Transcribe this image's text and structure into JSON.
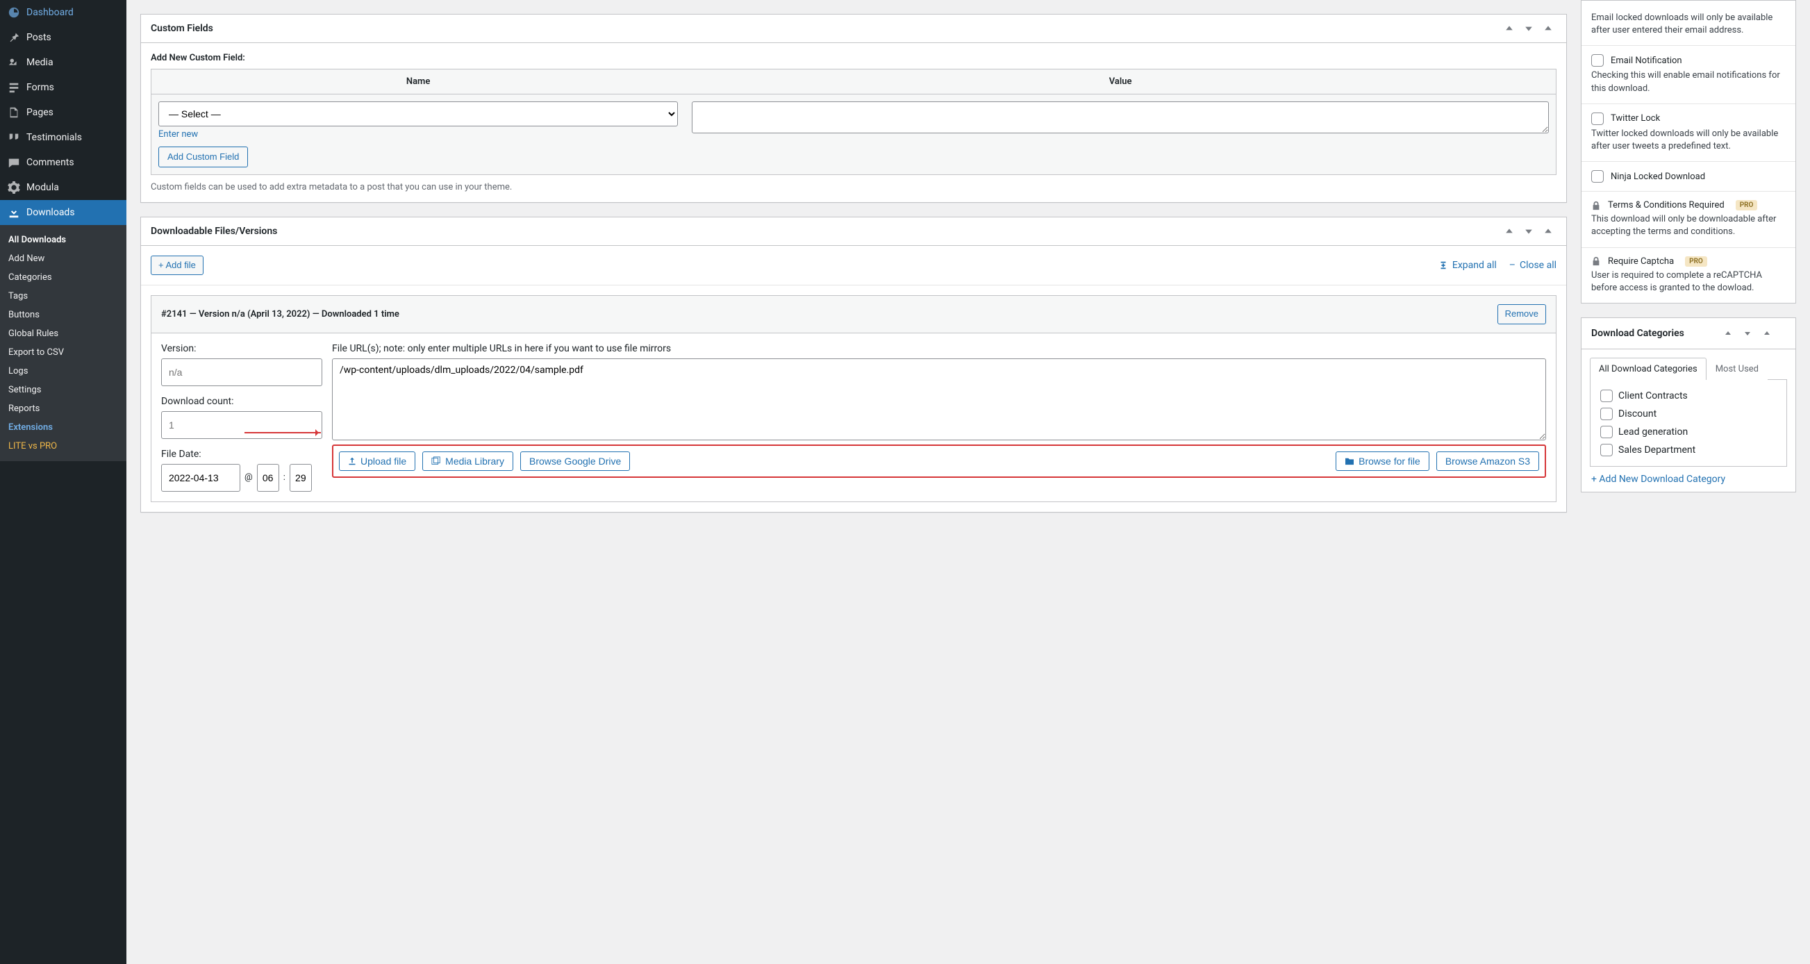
{
  "sidebar": {
    "items": [
      {
        "label": "Dashboard"
      },
      {
        "label": "Posts"
      },
      {
        "label": "Media"
      },
      {
        "label": "Forms"
      },
      {
        "label": "Pages"
      },
      {
        "label": "Testimonials"
      },
      {
        "label": "Comments"
      },
      {
        "label": "Modula"
      },
      {
        "label": "Downloads"
      }
    ],
    "submenu": [
      {
        "label": "All Downloads"
      },
      {
        "label": "Add New"
      },
      {
        "label": "Categories"
      },
      {
        "label": "Tags"
      },
      {
        "label": "Buttons"
      },
      {
        "label": "Global Rules"
      },
      {
        "label": "Export to CSV"
      },
      {
        "label": "Logs"
      },
      {
        "label": "Settings"
      },
      {
        "label": "Reports"
      },
      {
        "label": "Extensions"
      },
      {
        "label": "LITE vs PRO"
      }
    ]
  },
  "custom_fields": {
    "title": "Custom Fields",
    "add_label": "Add New Custom Field:",
    "col_name": "Name",
    "col_value": "Value",
    "select_placeholder": "— Select —",
    "enter_new": "Enter new",
    "add_btn": "Add Custom Field",
    "hint": "Custom fields can be used to add extra metadata to a post that you can use in your theme."
  },
  "downloadable": {
    "title": "Downloadable Files/Versions",
    "add_file": "Add file",
    "expand_all": "Expand all",
    "close_all": "Close all",
    "file_header": "#2141 — Version n/a (April 13, 2022) — Downloaded 1 time",
    "remove": "Remove",
    "version_label": "Version:",
    "version_placeholder": "n/a",
    "download_count_label": "Download count:",
    "download_count_placeholder": "1",
    "file_date_label": "File Date:",
    "date_value": "2022-04-13",
    "at_symbol": "@",
    "hour_value": "06",
    "colon": ":",
    "minute_value": "29",
    "file_url_label": "File URL(s); note: only enter multiple URLs in here if you want to use file mirrors",
    "file_url_value": "/wp-content/uploads/dlm_uploads/2022/04/sample.pdf",
    "upload_file": "Upload file",
    "media_library": "Media Library",
    "browse_gdrive": "Browse Google Drive",
    "browse_file": "Browse for file",
    "browse_s3": "Browse Amazon S3"
  },
  "options": {
    "email_lock_desc": "Email locked downloads will only be available after user entered their email address.",
    "email_notification": "Email Notification",
    "email_notification_desc": "Checking this will enable email notifications for this download.",
    "twitter_lock": "Twitter Lock",
    "twitter_lock_desc": "Twitter locked downloads will only be available after user tweets a predefined text.",
    "ninja_lock": "Ninja Locked Download",
    "terms": "Terms & Conditions Required",
    "terms_desc": "This download will only be downloadable after accepting the terms and conditions.",
    "captcha": "Require Captcha",
    "captcha_desc": "User is required to complete a reCAPTCHA before access is granted to the dowload.",
    "pro": "PRO"
  },
  "categories": {
    "title": "Download Categories",
    "tab_all": "All Download Categories",
    "tab_used": "Most Used",
    "items": [
      "Client Contracts",
      "Discount",
      "Lead generation",
      "Sales Department"
    ],
    "add_new": "+ Add New Download Category"
  }
}
